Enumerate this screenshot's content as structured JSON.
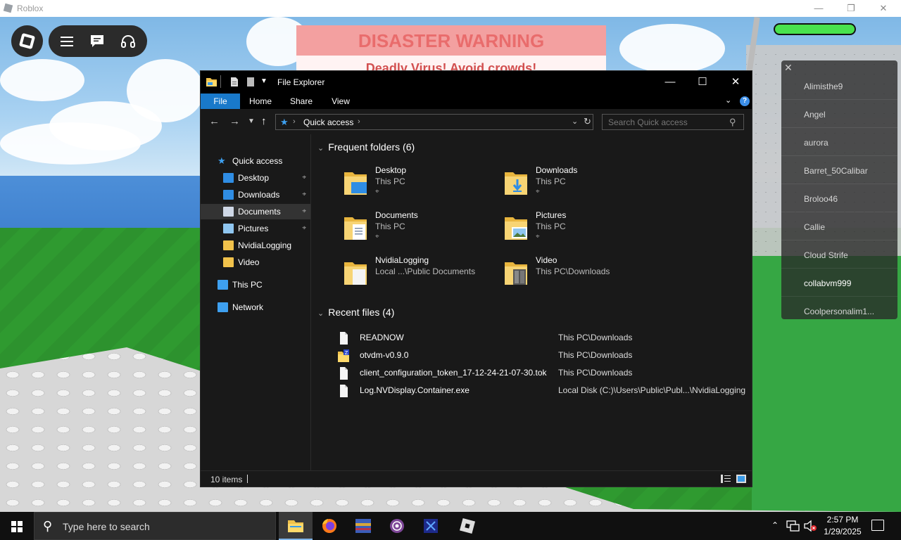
{
  "roblox": {
    "window_title": "Roblox",
    "sign_title": "DISASTER WARNING",
    "sign_subtitle": "Deadly Virus! Avoid crowds!",
    "health_fraction": 1.0,
    "players": [
      "Alimisthe9",
      "Angel",
      "aurora",
      "Barret_50Calibar",
      "Broloo46",
      "Callie",
      "Cloud Strife",
      "collabvm999",
      "Coolpersonalim1..."
    ],
    "current_player": "collabvm999"
  },
  "explorer": {
    "title": "File Explorer",
    "ribbon_tabs": [
      "File",
      "Home",
      "Share",
      "View"
    ],
    "help_label": "?",
    "address": "Quick access",
    "search_placeholder": "Search Quick access",
    "nav": [
      {
        "label": "Quick access",
        "pinned": false,
        "icon": "star-icon"
      },
      {
        "label": "Desktop",
        "pinned": true,
        "icon": "desktop-icon"
      },
      {
        "label": "Downloads",
        "pinned": true,
        "icon": "downloads-icon"
      },
      {
        "label": "Documents",
        "pinned": true,
        "icon": "documents-icon"
      },
      {
        "label": "Pictures",
        "pinned": true,
        "icon": "pictures-icon"
      },
      {
        "label": "NvidiaLogging",
        "pinned": false,
        "icon": "folder-icon"
      },
      {
        "label": "Video",
        "pinned": false,
        "icon": "folder-icon"
      },
      {
        "label": "This PC",
        "pinned": false,
        "icon": "this-pc-icon"
      },
      {
        "label": "Network",
        "pinned": false,
        "icon": "network-icon"
      }
    ],
    "selected_nav": "Documents",
    "frequent_header": "Frequent folders (6)",
    "frequent": [
      {
        "name": "Desktop",
        "location": "This PC",
        "pinned": true
      },
      {
        "name": "Downloads",
        "location": "This PC",
        "pinned": true
      },
      {
        "name": "Documents",
        "location": "This PC",
        "pinned": true
      },
      {
        "name": "Pictures",
        "location": "This PC",
        "pinned": true
      },
      {
        "name": "NvidiaLogging",
        "location": "Local ...\\Public Documents",
        "pinned": false
      },
      {
        "name": "Video",
        "location": "This PC\\Downloads",
        "pinned": false
      }
    ],
    "recent_header": "Recent files (4)",
    "recent": [
      {
        "name": "READNOW",
        "path": "This PC\\Downloads"
      },
      {
        "name": "otvdm-v0.9.0",
        "path": "This PC\\Downloads"
      },
      {
        "name": "client_configuration_token_17-12-24-21-07-30.tok",
        "path": "This PC\\Downloads"
      },
      {
        "name": "Log.NVDisplay.Container.exe",
        "path": "Local Disk (C:)\\Users\\Public\\Publ...\\NvidiaLogging"
      }
    ],
    "status_count": "10 items"
  },
  "taskbar": {
    "search_placeholder": "Type here to search",
    "time": "2:57 PM",
    "date": "1/29/2025",
    "apps": [
      "file-explorer-icon",
      "firefox-icon",
      "winrar-icon",
      "tor-icon",
      "app-icon",
      "roblox-icon"
    ]
  },
  "colors": {
    "accent": "#1979ca",
    "explorer_bg": "#191919",
    "health": "#49e24d"
  }
}
